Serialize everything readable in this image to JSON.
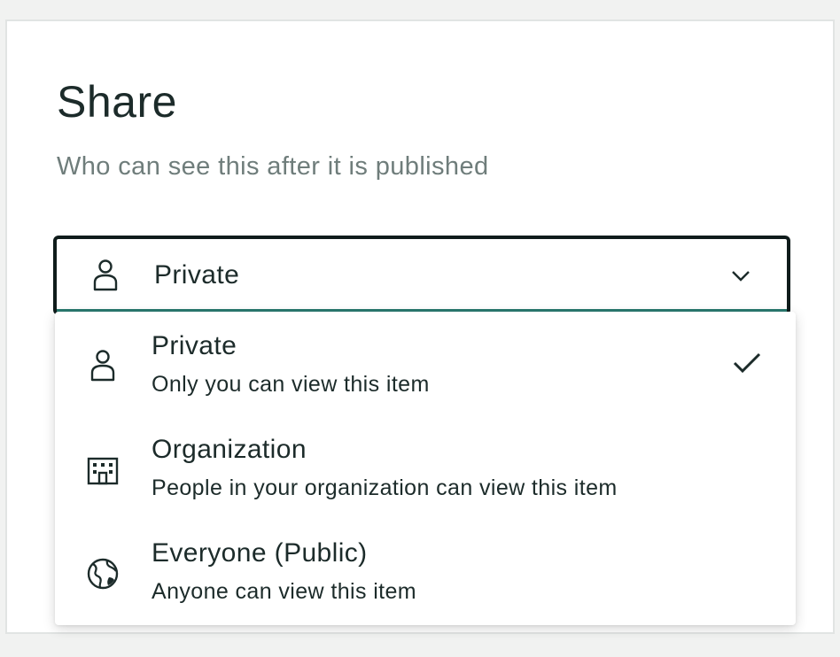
{
  "share": {
    "title": "Share",
    "subtitle": "Who can see this after it is published",
    "selected": {
      "label": "Private",
      "icon": "person-icon"
    },
    "options": [
      {
        "label": "Private",
        "description": "Only you can view this item",
        "icon": "person-icon",
        "checked": true
      },
      {
        "label": "Organization",
        "description": "People in your organization can view this item",
        "icon": "building-icon",
        "checked": false
      },
      {
        "label": "Everyone (Public)",
        "description": "Anyone can view this item",
        "icon": "globe-icon",
        "checked": false
      }
    ]
  },
  "colors": {
    "text": "#1c2b2a",
    "muted": "#6f7d7b",
    "accent": "#2a7a70"
  }
}
